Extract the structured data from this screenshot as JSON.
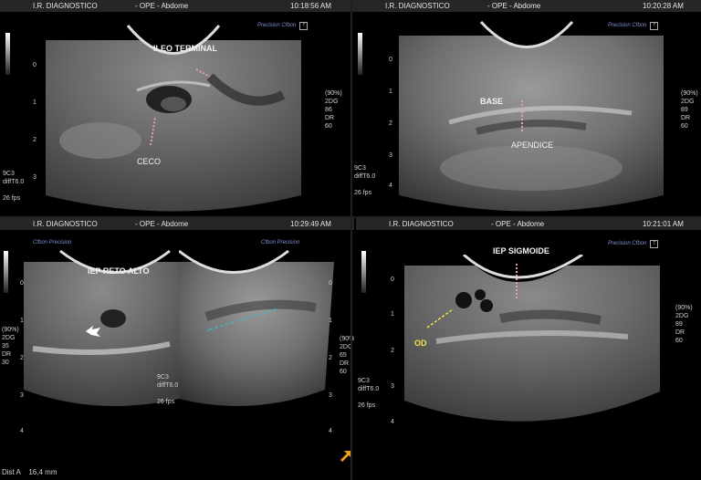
{
  "panels": [
    {
      "header": {
        "clinic": "I.R. DIAGNOSTICO",
        "exam": "- OPE -  Abdome",
        "time": "10:18:56 AM"
      },
      "labels": {
        "title": "ILEO TERMINAL",
        "structure": "CECO"
      },
      "depth_ticks": [
        "0",
        "1",
        "2",
        "3"
      ],
      "params": "(90%)\n2DG\n86\nDR\n60",
      "probe": "9C3\ndiffT6.0\n\n26 fps",
      "logos": "Precision  Cfbon"
    },
    {
      "header": {
        "clinic": "I.R. DIAGNOSTICO",
        "exam": "- OPE -  Abdome",
        "time": "10:20:28 AM"
      },
      "labels": {
        "title": "BASE",
        "structure": "APENDICE"
      },
      "depth_ticks": [
        "0",
        "1",
        "2",
        "3",
        "4"
      ],
      "params": "(90%)\n2DG\n89\nDR\n60",
      "probe": "9C3\ndiffT6.0\n\n26 fps",
      "logos": "Precision  Cfbon"
    },
    {
      "header": {
        "clinic": "I.R. DIAGNOSTICO",
        "exam": "- OPE -  Abdome",
        "time": "10:29:49 AM"
      },
      "labels": {
        "title": "IEP RETO ALTO"
      },
      "depth_ticks": [
        "0",
        "1",
        "2",
        "3",
        "4"
      ],
      "params_left": "(90%)\n2DG\n35\nDR\n30",
      "params": "(90%)\n2DG\n65\nDR\n60",
      "probe": "9C3\ndiffT6.0\n\n26 fps",
      "logos": "Cfbon  Precision",
      "measure": {
        "label": "Dist A",
        "value": "16,4",
        "unit": "mm"
      }
    },
    {
      "header": {
        "clinic": "I.R. DIAGNOSTICO",
        "exam": "- OPE -  Abdome",
        "time": "10:21:01 AM"
      },
      "labels": {
        "title": "IEP SIGMOIDE",
        "structure": "OD"
      },
      "depth_ticks": [
        "0",
        "1",
        "2",
        "3",
        "4"
      ],
      "params": "(90%)\n2DG\n89\nDR\n60",
      "probe": "9C3\ndiffT6.0\n\n26 fps",
      "logos": "Precision  Cfbon"
    }
  ],
  "colors": {
    "header_bg": "#262626",
    "caliper": "#e8a0a0",
    "od_label": "#f0e24a",
    "measure_line": "#3fb8c8",
    "arrow": "#f0a020"
  }
}
